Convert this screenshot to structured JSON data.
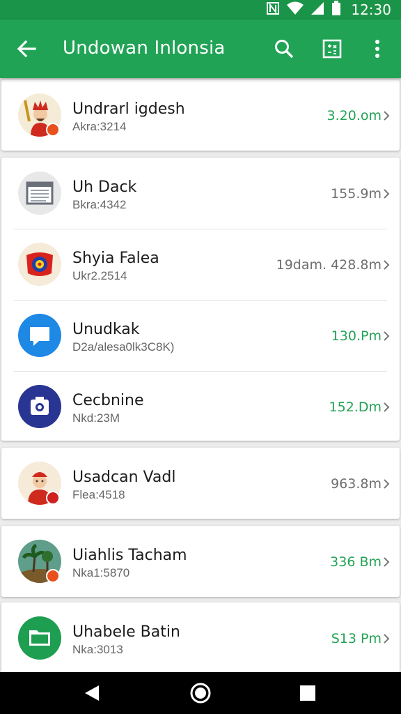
{
  "status_bar": {
    "time": "12:30"
  },
  "app_bar": {
    "title": "Undowan Inlonsia"
  },
  "items": [
    {
      "title": "Undrarl igdesh",
      "subtitle": "Akra:3214",
      "value": "3.20.om",
      "value_color": "green",
      "icon": "king-avatar-icon",
      "badge": true
    },
    {
      "title": "Uh Dack",
      "subtitle": "Bkra:4342",
      "value": "155.9m",
      "value_color": "gray",
      "icon": "document-icon",
      "badge": false
    },
    {
      "title": "Shyia Falea",
      "subtitle": "Ukr2.2514",
      "value": "19dam. 428.8m",
      "value_color": "gray",
      "icon": "flag-emblem-icon",
      "badge": false
    },
    {
      "title": "Unudkak",
      "subtitle": "D2a/alesa0lk3C8K)",
      "value": "130.Pm",
      "value_color": "green",
      "icon": "message-icon",
      "badge": false
    },
    {
      "title": "Cecbnine",
      "subtitle": "Nkd:23M",
      "value": "152.Dm",
      "value_color": "green",
      "icon": "camera-icon",
      "badge": false
    },
    {
      "title": "Usadcan Vadl",
      "subtitle": "Flea:4518",
      "value": "963.8m",
      "value_color": "gray",
      "icon": "person-avatar-icon",
      "badge": true
    },
    {
      "title": "Uiahlis Tacham",
      "subtitle": "Nka1:5870",
      "value": "336 Bm",
      "value_color": "green",
      "icon": "palm-tree-icon",
      "badge": true
    },
    {
      "title": "Uhabele Batin",
      "subtitle": "Nka:3013",
      "value": "S13 Pm",
      "value_color": "green",
      "icon": "folder-icon",
      "badge": false
    }
  ],
  "colors": {
    "app_bar": "#21a356",
    "status_bar": "#1a9448",
    "accent_green": "#22a355",
    "background": "#ececec"
  }
}
